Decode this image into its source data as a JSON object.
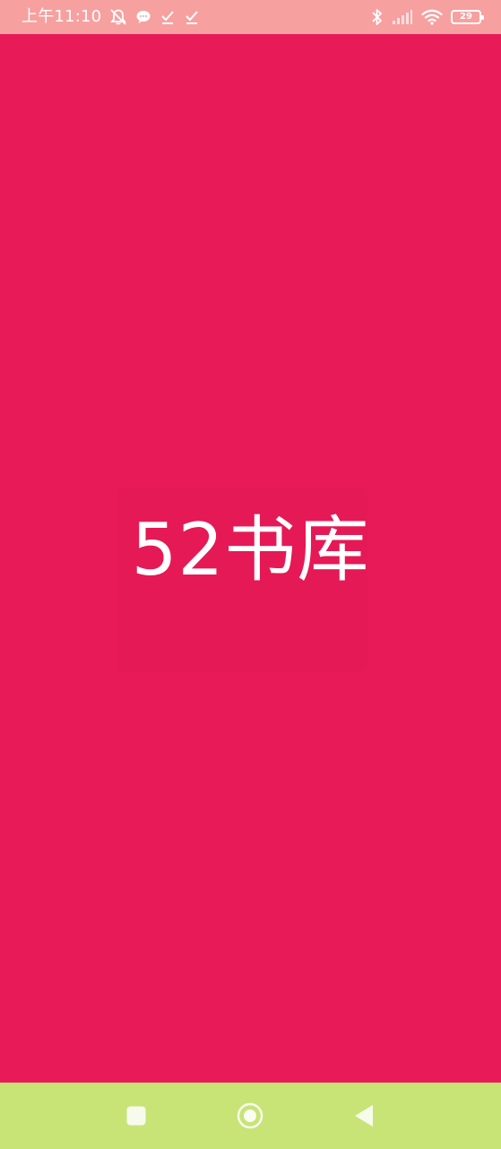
{
  "status_bar": {
    "time": "上午11:10",
    "battery_level": "29",
    "icons_left": [
      "notifications-off-icon",
      "chat-bubble-icon",
      "download-done-icon",
      "download-done-icon"
    ],
    "icons_right": [
      "bluetooth-icon",
      "signal-icon",
      "wifi-icon",
      "battery-icon"
    ]
  },
  "splash": {
    "app_name": "52书库"
  },
  "navigation": {
    "buttons": [
      "recent-apps-icon",
      "home-icon",
      "back-icon"
    ]
  },
  "colors": {
    "background": "#e91a58",
    "status_bar": "#f7a0a0",
    "nav_bar": "#c8e477",
    "text": "#ffffff"
  }
}
